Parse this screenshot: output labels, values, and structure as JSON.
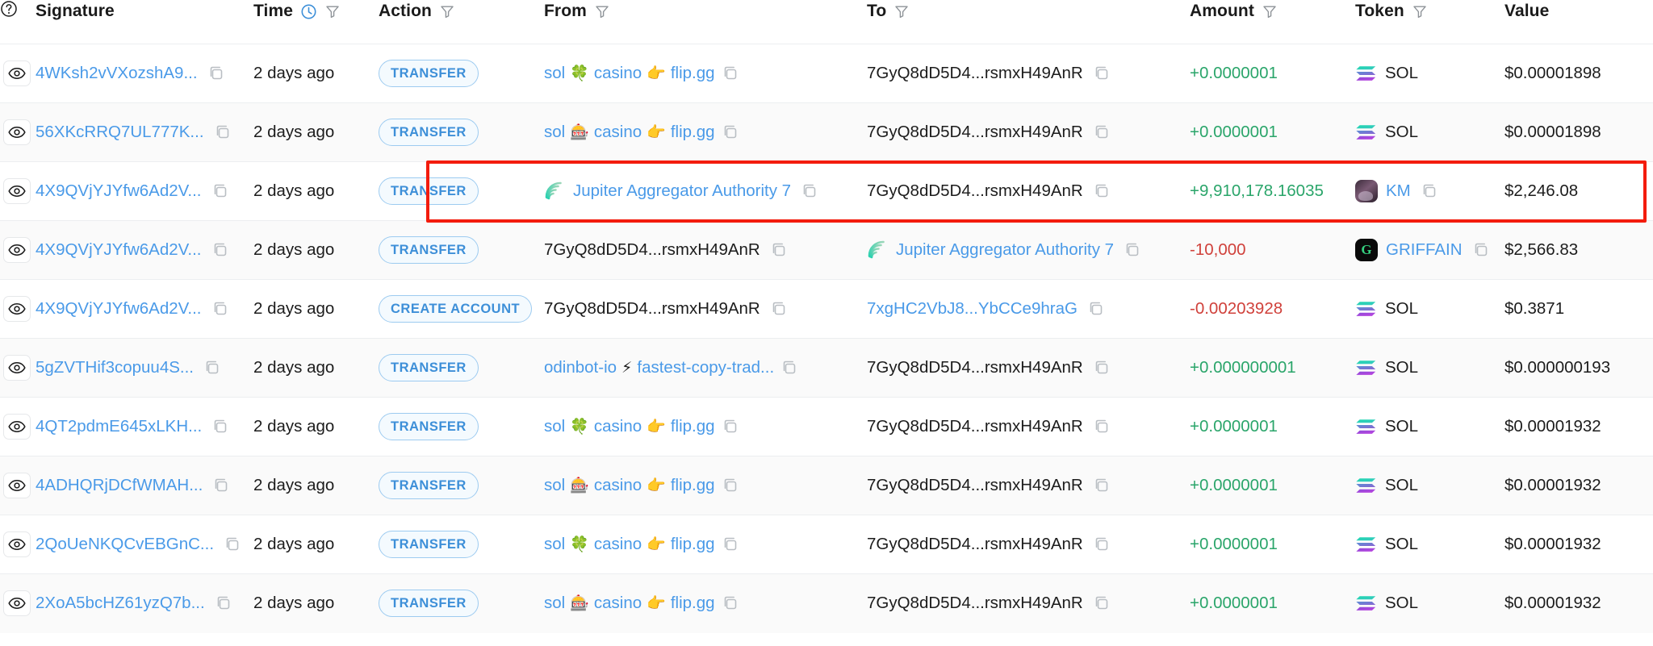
{
  "header": {
    "help_icon": "help-circle-icon",
    "columns": [
      {
        "key": "signature",
        "label": "Signature",
        "filter": false,
        "clock": false
      },
      {
        "key": "time",
        "label": "Time",
        "filter": true,
        "clock": true
      },
      {
        "key": "action",
        "label": "Action",
        "filter": true,
        "clock": false
      },
      {
        "key": "from",
        "label": "From",
        "filter": true,
        "clock": false
      },
      {
        "key": "to",
        "label": "To",
        "filter": true,
        "clock": false
      },
      {
        "key": "amount",
        "label": "Amount",
        "filter": true,
        "clock": false
      },
      {
        "key": "token",
        "label": "Token",
        "filter": true,
        "clock": false
      },
      {
        "key": "value",
        "label": "Value",
        "filter": false,
        "clock": false
      }
    ]
  },
  "colors": {
    "link": "#4a9ae8",
    "amount_positive": "#2aa56a",
    "amount_negative": "#d0413b",
    "badge_border": "#9dcbf0",
    "badge_text": "#3d8fd8",
    "highlight_border": "#f31c0d",
    "row_alt_background": "#fafafa"
  },
  "highlight": {
    "row_index": 2,
    "color": "#f31c0d",
    "note": "red-rectangle-annotation"
  },
  "rows": [
    {
      "eye_icon": "eye-icon",
      "signature": "4WKsh2vVXozshA9...",
      "time": "2 days ago",
      "action": "TRANSFER",
      "from": {
        "kind": "label",
        "prefix": "sol",
        "emoji": "🍀",
        "mid": "casino",
        "emoji2": "👉",
        "suffix": "flip.gg",
        "copy": true
      },
      "to": {
        "kind": "address",
        "text": "7GyQ8dD5D4...rsmxH49AnR",
        "link": false,
        "copy": true
      },
      "amount": "+0.0000001",
      "amount_sign": "positive",
      "token": {
        "symbol": "SOL",
        "icon": "sol-token-icon",
        "copy": false
      },
      "value": "$0.00001898"
    },
    {
      "eye_icon": "eye-icon",
      "signature": "56XKcRRQ7UL777K...",
      "time": "2 days ago",
      "action": "TRANSFER",
      "from": {
        "kind": "label",
        "prefix": "sol",
        "emoji": "🎰",
        "mid": "casino",
        "emoji2": "👉",
        "suffix": "flip.gg",
        "copy": true
      },
      "to": {
        "kind": "address",
        "text": "7GyQ8dD5D4...rsmxH49AnR",
        "link": false,
        "copy": true
      },
      "amount": "+0.0000001",
      "amount_sign": "positive",
      "token": {
        "symbol": "SOL",
        "icon": "sol-token-icon",
        "copy": false
      },
      "value": "$0.00001898"
    },
    {
      "eye_icon": "eye-icon",
      "signature": "4X9QVjYJYfw6Ad2V...",
      "time": "2 days ago",
      "action": "TRANSFER",
      "from": {
        "kind": "named",
        "icon": "jupiter-logo-icon",
        "text": "Jupiter Aggregator Authority 7",
        "copy": true
      },
      "to": {
        "kind": "address",
        "text": "7GyQ8dD5D4...rsmxH49AnR",
        "link": false,
        "copy": true
      },
      "amount": "+9,910,178.16035",
      "amount_sign": "positive",
      "token": {
        "symbol": "KM",
        "icon": "km-token-icon",
        "copy": true,
        "link": true
      },
      "value": "$2,246.08"
    },
    {
      "eye_icon": "eye-icon",
      "signature": "4X9QVjYJYfw6Ad2V...",
      "time": "2 days ago",
      "action": "TRANSFER",
      "from": {
        "kind": "address",
        "text": "7GyQ8dD5D4...rsmxH49AnR",
        "link": false,
        "copy": true
      },
      "to": {
        "kind": "named",
        "icon": "jupiter-logo-icon",
        "text": "Jupiter Aggregator Authority 7",
        "copy": true
      },
      "amount": "-10,000",
      "amount_sign": "negative",
      "token": {
        "symbol": "GRIFFAIN",
        "icon": "griffain-token-icon",
        "copy": true,
        "link": true
      },
      "value": "$2,566.83"
    },
    {
      "eye_icon": "eye-icon",
      "signature": "4X9QVjYJYfw6Ad2V...",
      "time": "2 days ago",
      "action": "CREATE ACCOUNT",
      "from": {
        "kind": "address",
        "text": "7GyQ8dD5D4...rsmxH49AnR",
        "link": false,
        "copy": true
      },
      "to": {
        "kind": "address",
        "text": "7xgHC2VbJ8...YbCCe9hraG",
        "link": true,
        "copy": true
      },
      "amount": "-0.00203928",
      "amount_sign": "negative",
      "token": {
        "symbol": "SOL",
        "icon": "sol-token-icon",
        "copy": false
      },
      "value": "$0.3871"
    },
    {
      "eye_icon": "eye-icon",
      "signature": "5gZVTHif3copuu4S...",
      "time": "2 days ago",
      "action": "TRANSFER",
      "from": {
        "kind": "label",
        "prefix": "odinbot-io",
        "emoji": "⚡",
        "mid": "fastest-copy-trad...",
        "emoji2": "",
        "suffix": "",
        "copy": true
      },
      "to": {
        "kind": "address",
        "text": "7GyQ8dD5D4...rsmxH49AnR",
        "link": false,
        "copy": true
      },
      "amount": "+0.000000001",
      "amount_sign": "positive",
      "token": {
        "symbol": "SOL",
        "icon": "sol-token-icon",
        "copy": false
      },
      "value": "$0.000000193"
    },
    {
      "eye_icon": "eye-icon",
      "signature": "4QT2pdmE645xLKH...",
      "time": "2 days ago",
      "action": "TRANSFER",
      "from": {
        "kind": "label",
        "prefix": "sol",
        "emoji": "🍀",
        "mid": "casino",
        "emoji2": "👉",
        "suffix": "flip.gg",
        "copy": true
      },
      "to": {
        "kind": "address",
        "text": "7GyQ8dD5D4...rsmxH49AnR",
        "link": false,
        "copy": true
      },
      "amount": "+0.0000001",
      "amount_sign": "positive",
      "token": {
        "symbol": "SOL",
        "icon": "sol-token-icon",
        "copy": false
      },
      "value": "$0.00001932"
    },
    {
      "eye_icon": "eye-icon",
      "signature": "4ADHQRjDCfWMAH...",
      "time": "2 days ago",
      "action": "TRANSFER",
      "from": {
        "kind": "label",
        "prefix": "sol",
        "emoji": "🎰",
        "mid": "casino",
        "emoji2": "👉",
        "suffix": "flip.gg",
        "copy": true
      },
      "to": {
        "kind": "address",
        "text": "7GyQ8dD5D4...rsmxH49AnR",
        "link": false,
        "copy": true
      },
      "amount": "+0.0000001",
      "amount_sign": "positive",
      "token": {
        "symbol": "SOL",
        "icon": "sol-token-icon",
        "copy": false
      },
      "value": "$0.00001932"
    },
    {
      "eye_icon": "eye-icon",
      "signature": "2QoUeNKQCvEBGnC...",
      "time": "2 days ago",
      "action": "TRANSFER",
      "from": {
        "kind": "label",
        "prefix": "sol",
        "emoji": "🍀",
        "mid": "casino",
        "emoji2": "👉",
        "suffix": "flip.gg",
        "copy": true
      },
      "to": {
        "kind": "address",
        "text": "7GyQ8dD5D4...rsmxH49AnR",
        "link": false,
        "copy": true
      },
      "amount": "+0.0000001",
      "amount_sign": "positive",
      "token": {
        "symbol": "SOL",
        "icon": "sol-token-icon",
        "copy": false
      },
      "value": "$0.00001932"
    },
    {
      "eye_icon": "eye-icon",
      "signature": "2XoA5bcHZ61yzQ7b...",
      "time": "2 days ago",
      "action": "TRANSFER",
      "from": {
        "kind": "label",
        "prefix": "sol",
        "emoji": "🎰",
        "mid": "casino",
        "emoji2": "👉",
        "suffix": "flip.gg",
        "copy": true
      },
      "to": {
        "kind": "address",
        "text": "7GyQ8dD5D4...rsmxH49AnR",
        "link": false,
        "copy": true
      },
      "amount": "+0.0000001",
      "amount_sign": "positive",
      "token": {
        "symbol": "SOL",
        "icon": "sol-token-icon",
        "copy": false
      },
      "value": "$0.00001932"
    }
  ]
}
